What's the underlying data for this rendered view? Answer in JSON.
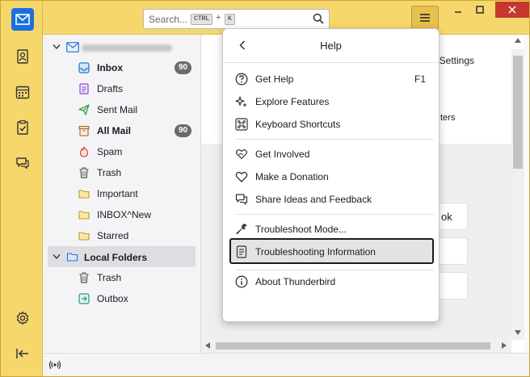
{
  "search": {
    "placeholder": "Search...",
    "key1": "CTRL",
    "plus": "+",
    "key2": "K"
  },
  "account": {
    "name_hidden": true
  },
  "folders": [
    {
      "name": "Inbox",
      "badge": "90",
      "bold": true,
      "icon": "inbox-icon"
    },
    {
      "name": "Drafts",
      "badge": "",
      "bold": false,
      "icon": "drafts-icon"
    },
    {
      "name": "Sent Mail",
      "badge": "",
      "bold": false,
      "icon": "sent-icon"
    },
    {
      "name": "All Mail",
      "badge": "90",
      "bold": true,
      "icon": "archive-icon"
    },
    {
      "name": "Spam",
      "badge": "",
      "bold": false,
      "icon": "spam-icon"
    },
    {
      "name": "Trash",
      "badge": "",
      "bold": false,
      "icon": "trash-icon"
    },
    {
      "name": "Important",
      "badge": "",
      "bold": false,
      "icon": "folder-icon"
    },
    {
      "name": "INBOX^New",
      "badge": "",
      "bold": false,
      "icon": "folder-icon"
    },
    {
      "name": "Starred",
      "badge": "",
      "bold": false,
      "icon": "folder-icon"
    }
  ],
  "local_folders": {
    "label": "Local Folders",
    "items": [
      {
        "name": "Trash",
        "icon": "trash-icon"
      },
      {
        "name": "Outbox",
        "icon": "outbox-icon"
      }
    ]
  },
  "background_text": {
    "settings": "t Settings",
    "filters": "ters",
    "ok": "ok"
  },
  "help_menu": {
    "title": "Help",
    "items": [
      {
        "label": "Get Help",
        "key": "F1",
        "icon": "question-icon"
      },
      {
        "label": "Explore Features",
        "key": "",
        "icon": "sparkle-icon"
      },
      {
        "label": "Keyboard Shortcuts",
        "key": "",
        "icon": "command-key-icon"
      },
      {
        "label": "Get Involved",
        "key": "",
        "icon": "heart-hands-icon"
      },
      {
        "label": "Make a Donation",
        "key": "",
        "icon": "heart-icon"
      },
      {
        "label": "Share Ideas and Feedback",
        "key": "",
        "icon": "speech-bubble-icon"
      },
      {
        "label": "Troubleshoot Mode...",
        "key": "",
        "icon": "wrench-icon"
      },
      {
        "label": "Troubleshooting Information",
        "key": "",
        "icon": "document-icon"
      },
      {
        "label": "About Thunderbird",
        "key": "",
        "icon": "info-icon"
      }
    ]
  },
  "colors": {
    "titlebar": "#f6d76b",
    "accent": "#1c6fe0",
    "badge": "#6b6b6b",
    "close": "#c7372f"
  }
}
